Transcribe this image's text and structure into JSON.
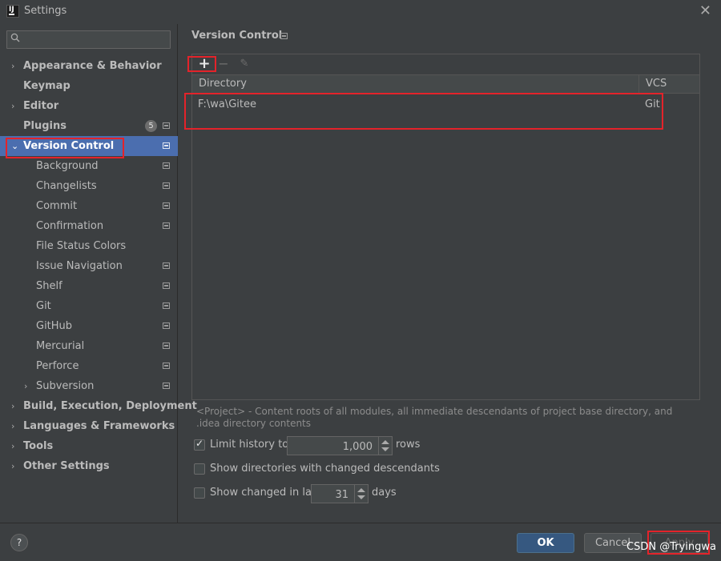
{
  "window": {
    "title": "Settings",
    "close_glyph": "✕"
  },
  "search": {
    "value": "",
    "placeholder": ""
  },
  "sidebar": {
    "items": [
      {
        "label": "Appearance & Behavior",
        "level": 0,
        "arrow": "›",
        "project_icon": false
      },
      {
        "label": "Keymap",
        "level": 0,
        "arrow": "",
        "project_icon": false
      },
      {
        "label": "Editor",
        "level": 0,
        "arrow": "›",
        "project_icon": false
      },
      {
        "label": "Plugins",
        "level": 0,
        "arrow": "",
        "badge": "5",
        "project_icon": true
      },
      {
        "label": "Version Control",
        "level": 0,
        "arrow": "⌄",
        "selected": true,
        "project_icon": true
      },
      {
        "label": "Background",
        "level": 1,
        "arrow": "",
        "project_icon": true
      },
      {
        "label": "Changelists",
        "level": 1,
        "arrow": "",
        "project_icon": true
      },
      {
        "label": "Commit",
        "level": 1,
        "arrow": "",
        "project_icon": true
      },
      {
        "label": "Confirmation",
        "level": 1,
        "arrow": "",
        "project_icon": true
      },
      {
        "label": "File Status Colors",
        "level": 1,
        "arrow": "",
        "project_icon": false
      },
      {
        "label": "Issue Navigation",
        "level": 1,
        "arrow": "",
        "project_icon": true
      },
      {
        "label": "Shelf",
        "level": 1,
        "arrow": "",
        "project_icon": true
      },
      {
        "label": "Git",
        "level": 1,
        "arrow": "",
        "project_icon": true
      },
      {
        "label": "GitHub",
        "level": 1,
        "arrow": "",
        "project_icon": true
      },
      {
        "label": "Mercurial",
        "level": 1,
        "arrow": "",
        "project_icon": true
      },
      {
        "label": "Perforce",
        "level": 1,
        "arrow": "",
        "project_icon": true
      },
      {
        "label": "Subversion",
        "level": 1,
        "arrow": "›",
        "project_icon": true
      },
      {
        "label": "Build, Execution, Deployment",
        "level": 0,
        "arrow": "›",
        "project_icon": false
      },
      {
        "label": "Languages & Frameworks",
        "level": 0,
        "arrow": "›",
        "project_icon": false
      },
      {
        "label": "Tools",
        "level": 0,
        "arrow": "›",
        "project_icon": false
      },
      {
        "label": "Other Settings",
        "level": 0,
        "arrow": "›",
        "project_icon": false
      }
    ]
  },
  "main": {
    "title": "Version Control",
    "toolbar": {
      "add": "+",
      "remove": "−",
      "edit": "✎"
    },
    "table": {
      "columns": [
        "Directory",
        "VCS"
      ],
      "rows": [
        {
          "directory": "F:\\wa\\Gitee",
          "vcs": "Git"
        }
      ]
    },
    "hint": "<Project> - Content roots of all modules, all immediate descendants of project base directory, and .idea directory contents",
    "options": {
      "limit_history": {
        "label": "Limit history to:",
        "checked": true,
        "value": "1,000",
        "suffix": "rows"
      },
      "show_dirs": {
        "label": "Show directories with changed descendants",
        "checked": false
      },
      "show_changed": {
        "label": "Show changed in last",
        "checked": false,
        "value": "31",
        "suffix": "days"
      }
    }
  },
  "footer": {
    "help": "?",
    "ok": "OK",
    "cancel": "Cancel",
    "apply": "Apply"
  },
  "watermark": "CSDN @Tryingwa",
  "colors": {
    "selection": "#4b6eaf",
    "highlight_box": "#e4232a",
    "ok_button": "#365880",
    "background": "#3c3f41"
  }
}
